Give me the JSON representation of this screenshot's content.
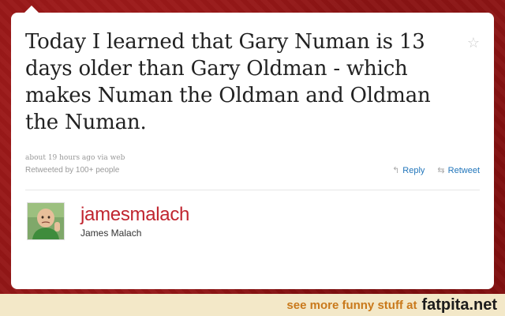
{
  "tweet": {
    "text": "Today I learned that Gary Numan is 13 days older than Gary Oldman - which makes Numan the Oldman and Oldman the Numan.",
    "timestamp": "about 19 hours ago",
    "via_prefix": "via",
    "via_source": "web",
    "retweeted_by": "Retweeted by 100+ people",
    "favorite_icon": "star-icon",
    "actions": {
      "reply_label": "Reply",
      "reply_icon": "reply-arrow-icon",
      "retweet_label": "Retweet",
      "retweet_icon": "retweet-icon"
    }
  },
  "author": {
    "username": "jamesmalach",
    "full_name": "James Malach",
    "avatar_icon": "avatar-photo"
  },
  "footer": {
    "text": "see more funny stuff at",
    "site": "fatpita.net"
  },
  "colors": {
    "background": "#8e1515",
    "username": "#c0252f",
    "link": "#2276bb",
    "footer_bg": "#f3e8c8",
    "footer_text": "#c9791b"
  }
}
